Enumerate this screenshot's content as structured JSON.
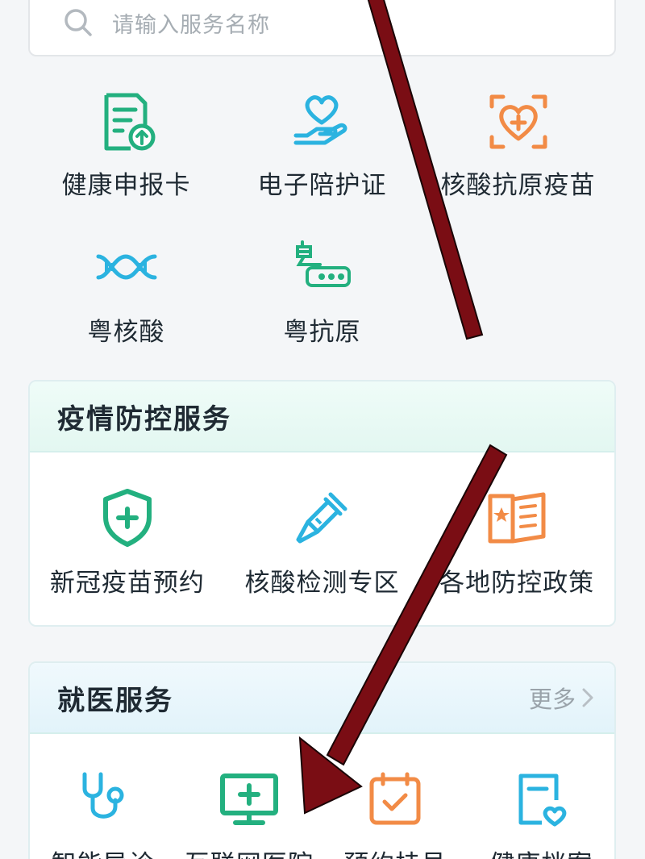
{
  "search": {
    "placeholder": "请输入服务名称",
    "icon": "search-icon"
  },
  "quick_services": [
    {
      "label": "健康申报卡",
      "icon": "health-declaration-card-icon"
    },
    {
      "label": "电子陪护证",
      "icon": "heart-hand-icon"
    },
    {
      "label": "核酸抗原疫苗",
      "icon": "heart-scan-icon"
    },
    {
      "label": "粤核酸",
      "icon": "dna-icon"
    },
    {
      "label": "粤抗原",
      "icon": "yue-antigen-icon"
    }
  ],
  "epidemic_section": {
    "title": "疫情防控服务",
    "items": [
      {
        "label": "新冠疫苗预约",
        "icon": "shield-plus-icon"
      },
      {
        "label": "核酸检测专区",
        "icon": "test-swab-icon"
      },
      {
        "label": "各地防控政策",
        "icon": "policy-book-icon"
      }
    ]
  },
  "medical_section": {
    "title": "就医服务",
    "more_label": "更多",
    "items": [
      {
        "label": "智能导诊",
        "icon": "stethoscope-icon"
      },
      {
        "label": "互联网医院",
        "icon": "monitor-plus-icon"
      },
      {
        "label": "预约挂号",
        "icon": "calendar-check-icon"
      },
      {
        "label": "健康档案",
        "icon": "health-record-icon"
      }
    ]
  },
  "colors": {
    "green": "#23b07f",
    "blue": "#2bb3e0",
    "orange": "#f28b46",
    "arrow": "#7a0d14"
  }
}
